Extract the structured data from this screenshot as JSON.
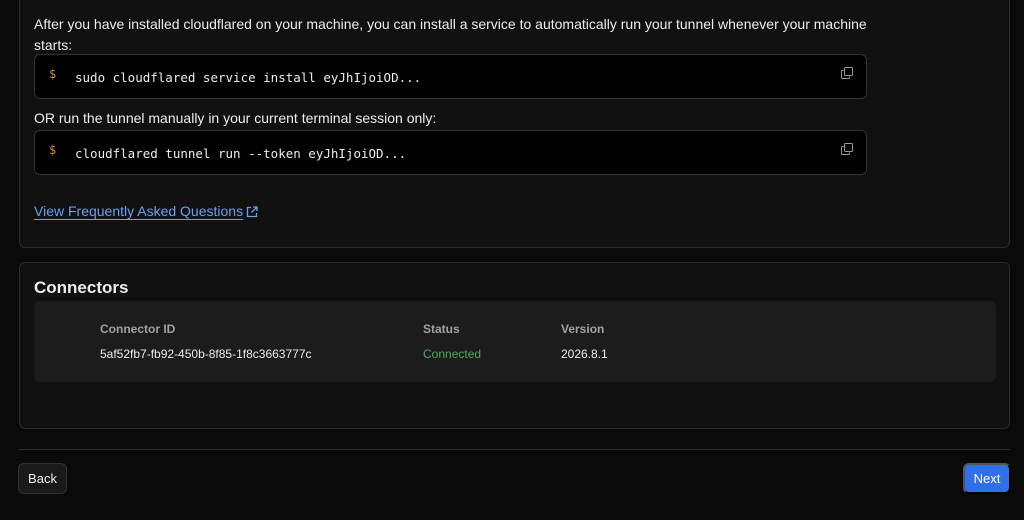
{
  "setup": {
    "intro_text": "After you have installed cloudflared on your machine, you can install a service to automatically run your tunnel whenever your machine starts:",
    "prompt_symbol": "$",
    "service_command": "sudo cloudflared service install eyJhIjoiOD...",
    "or_text": "OR run the tunnel manually in your current terminal session only:",
    "manual_command": "cloudflared tunnel run --token eyJhIjoiOD...",
    "faq_link": "View Frequently Asked Questions"
  },
  "connectors": {
    "title": "Connectors",
    "columns": [
      "Connector ID",
      "Status",
      "Version"
    ],
    "rows": [
      {
        "id": "5af52fb7-fb92-450b-8f85-1f8c3663777c",
        "status": "Connected",
        "version": "2026.8.1"
      }
    ]
  },
  "footer": {
    "back_label": "Back",
    "next_label": "Next"
  },
  "colors": {
    "accent": "#2f6fea",
    "link": "#6aa0f0",
    "status_connected": "#4fa85a",
    "prompt": "#c9853a"
  },
  "icons": {
    "copy": "copy-icon",
    "external": "external-link-icon"
  }
}
